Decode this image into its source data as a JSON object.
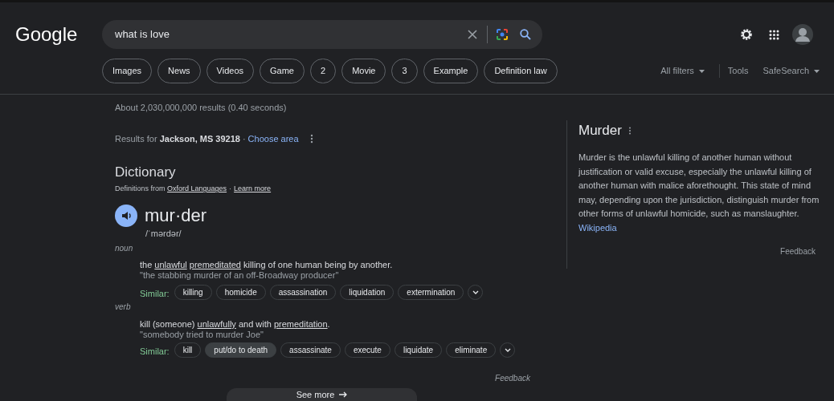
{
  "header": {
    "logo": "Google",
    "search": {
      "value": "what is love"
    },
    "chips": [
      "Images",
      "News",
      "Videos",
      "Game",
      "2",
      "Movie",
      "3",
      "Example",
      "Definition law"
    ],
    "tools": [
      {
        "label": "All filters",
        "dropdown": true
      },
      {
        "label": "Tools",
        "dropdown": false
      },
      {
        "label": "SafeSearch",
        "dropdown": true
      }
    ]
  },
  "stats": "About 2,030,000,000 results (0.40 seconds)",
  "location": {
    "prefix": "Results for ",
    "place": "Jackson, MS 39218",
    "separator": "·",
    "link": "Choose area"
  },
  "dictionary": {
    "title": "Dictionary",
    "source_prefix": "Definitions from ",
    "source": "Oxford Languages",
    "separator": "·",
    "learn_more": "Learn more",
    "word": "mur·der",
    "pronunciation": "/ˈmərdər/",
    "senses": [
      {
        "pos": "noun",
        "definition": [
          {
            "text": "the ",
            "link": false
          },
          {
            "text": "unlawful",
            "link": true
          },
          {
            "text": "premeditated",
            "link": true
          },
          {
            "text": " killing of one human being by another.",
            "link": false
          }
        ],
        "example": "\"the stabbing murder of an off-Broadway producer\"",
        "similar_label": "Similar:",
        "similar": [
          {
            "label": "killing",
            "selected": false
          },
          {
            "label": "homicide",
            "selected": false
          },
          {
            "label": "assassination",
            "selected": false
          },
          {
            "label": "liquidation",
            "selected": false
          },
          {
            "label": "extermination",
            "selected": false
          }
        ]
      },
      {
        "pos": "verb",
        "definition": [
          {
            "text": "kill (someone) ",
            "link": false
          },
          {
            "text": "unlawfully",
            "link": true
          },
          {
            "text": " and with ",
            "link": false
          },
          {
            "text": "premeditation",
            "link": true
          },
          {
            "text": ".",
            "link": false
          }
        ],
        "example": "\"somebody tried to murder Joe\"",
        "similar_label": "Similar:",
        "similar": [
          {
            "label": "kill",
            "selected": false
          },
          {
            "label": "put/do to death",
            "selected": true
          },
          {
            "label": "assassinate",
            "selected": false
          },
          {
            "label": "execute",
            "selected": false
          },
          {
            "label": "liquidate",
            "selected": false
          },
          {
            "label": "eliminate",
            "selected": false
          }
        ]
      }
    ],
    "feedback": "Feedback",
    "see_more": "See more"
  },
  "panel": {
    "title": "Murder",
    "description": "Murder is the unlawful killing of another human without justification or valid excuse, especially the unlawful killing of another human with malice aforethought. This state of mind may, depending upon the jurisdiction, distinguish murder from other forms of unlawful homicide, such as manslaughter.",
    "source": "Wikipedia",
    "feedback": "Feedback"
  }
}
